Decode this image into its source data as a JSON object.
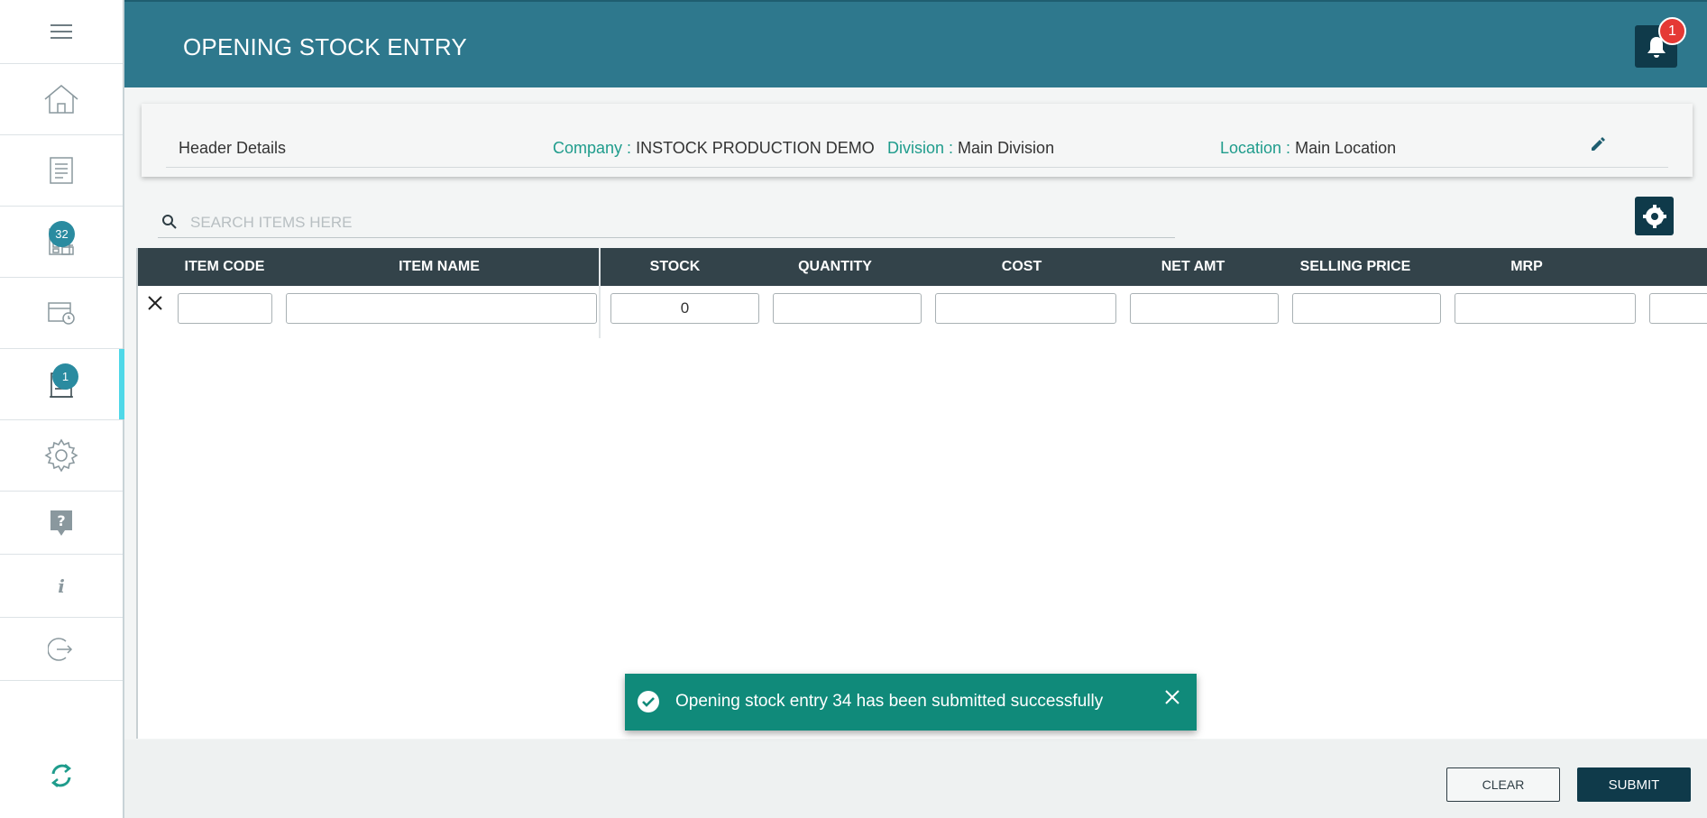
{
  "app": {
    "title": "OPENING STOCK ENTRY",
    "notification_count": "1",
    "accent_color": "#2e788d",
    "dark_color": "#0f3a4a"
  },
  "sidebar": {
    "items": [
      {
        "name": "menu",
        "icon": "hamburger-icon"
      },
      {
        "name": "home",
        "icon": "home-icon"
      },
      {
        "name": "reports",
        "icon": "document-icon"
      },
      {
        "name": "orders",
        "icon": "invoice-icon",
        "badge": "32"
      },
      {
        "name": "stock",
        "icon": "box-clock-icon"
      },
      {
        "name": "opening-stock",
        "icon": "entry-icon",
        "badge": "1",
        "active": true
      },
      {
        "name": "settings",
        "icon": "gear-icon"
      },
      {
        "name": "help",
        "icon": "help-icon"
      },
      {
        "name": "info",
        "icon": "info-icon"
      },
      {
        "name": "logout",
        "icon": "logout-icon"
      },
      {
        "name": "sync",
        "icon": "sync-icon"
      }
    ]
  },
  "header": {
    "title": "Header Details",
    "company_label": "Company :",
    "company_value": "INSTOCK PRODUCTION DEMO",
    "division_label": "Division :",
    "division_value": "Main Division",
    "location_label": "Location :",
    "location_value": "Main Location"
  },
  "search": {
    "placeholder": "SEARCH ITEMS HERE",
    "value": ""
  },
  "table": {
    "columns": [
      "ITEM CODE",
      "ITEM NAME",
      "STOCK",
      "QUANTITY",
      "COST",
      "NET AMT",
      "SELLING PRICE",
      "MRP"
    ],
    "row": {
      "item_code": "",
      "item_name": "",
      "stock": "0",
      "quantity": "",
      "cost": "",
      "net_amt": "",
      "selling_price": "",
      "mrp": ""
    }
  },
  "toast": {
    "message": "Opening stock entry 34 has been submitted successfully",
    "color": "#108a7a"
  },
  "footer": {
    "clear_label": "CLEAR",
    "submit_label": "SUBMIT"
  }
}
